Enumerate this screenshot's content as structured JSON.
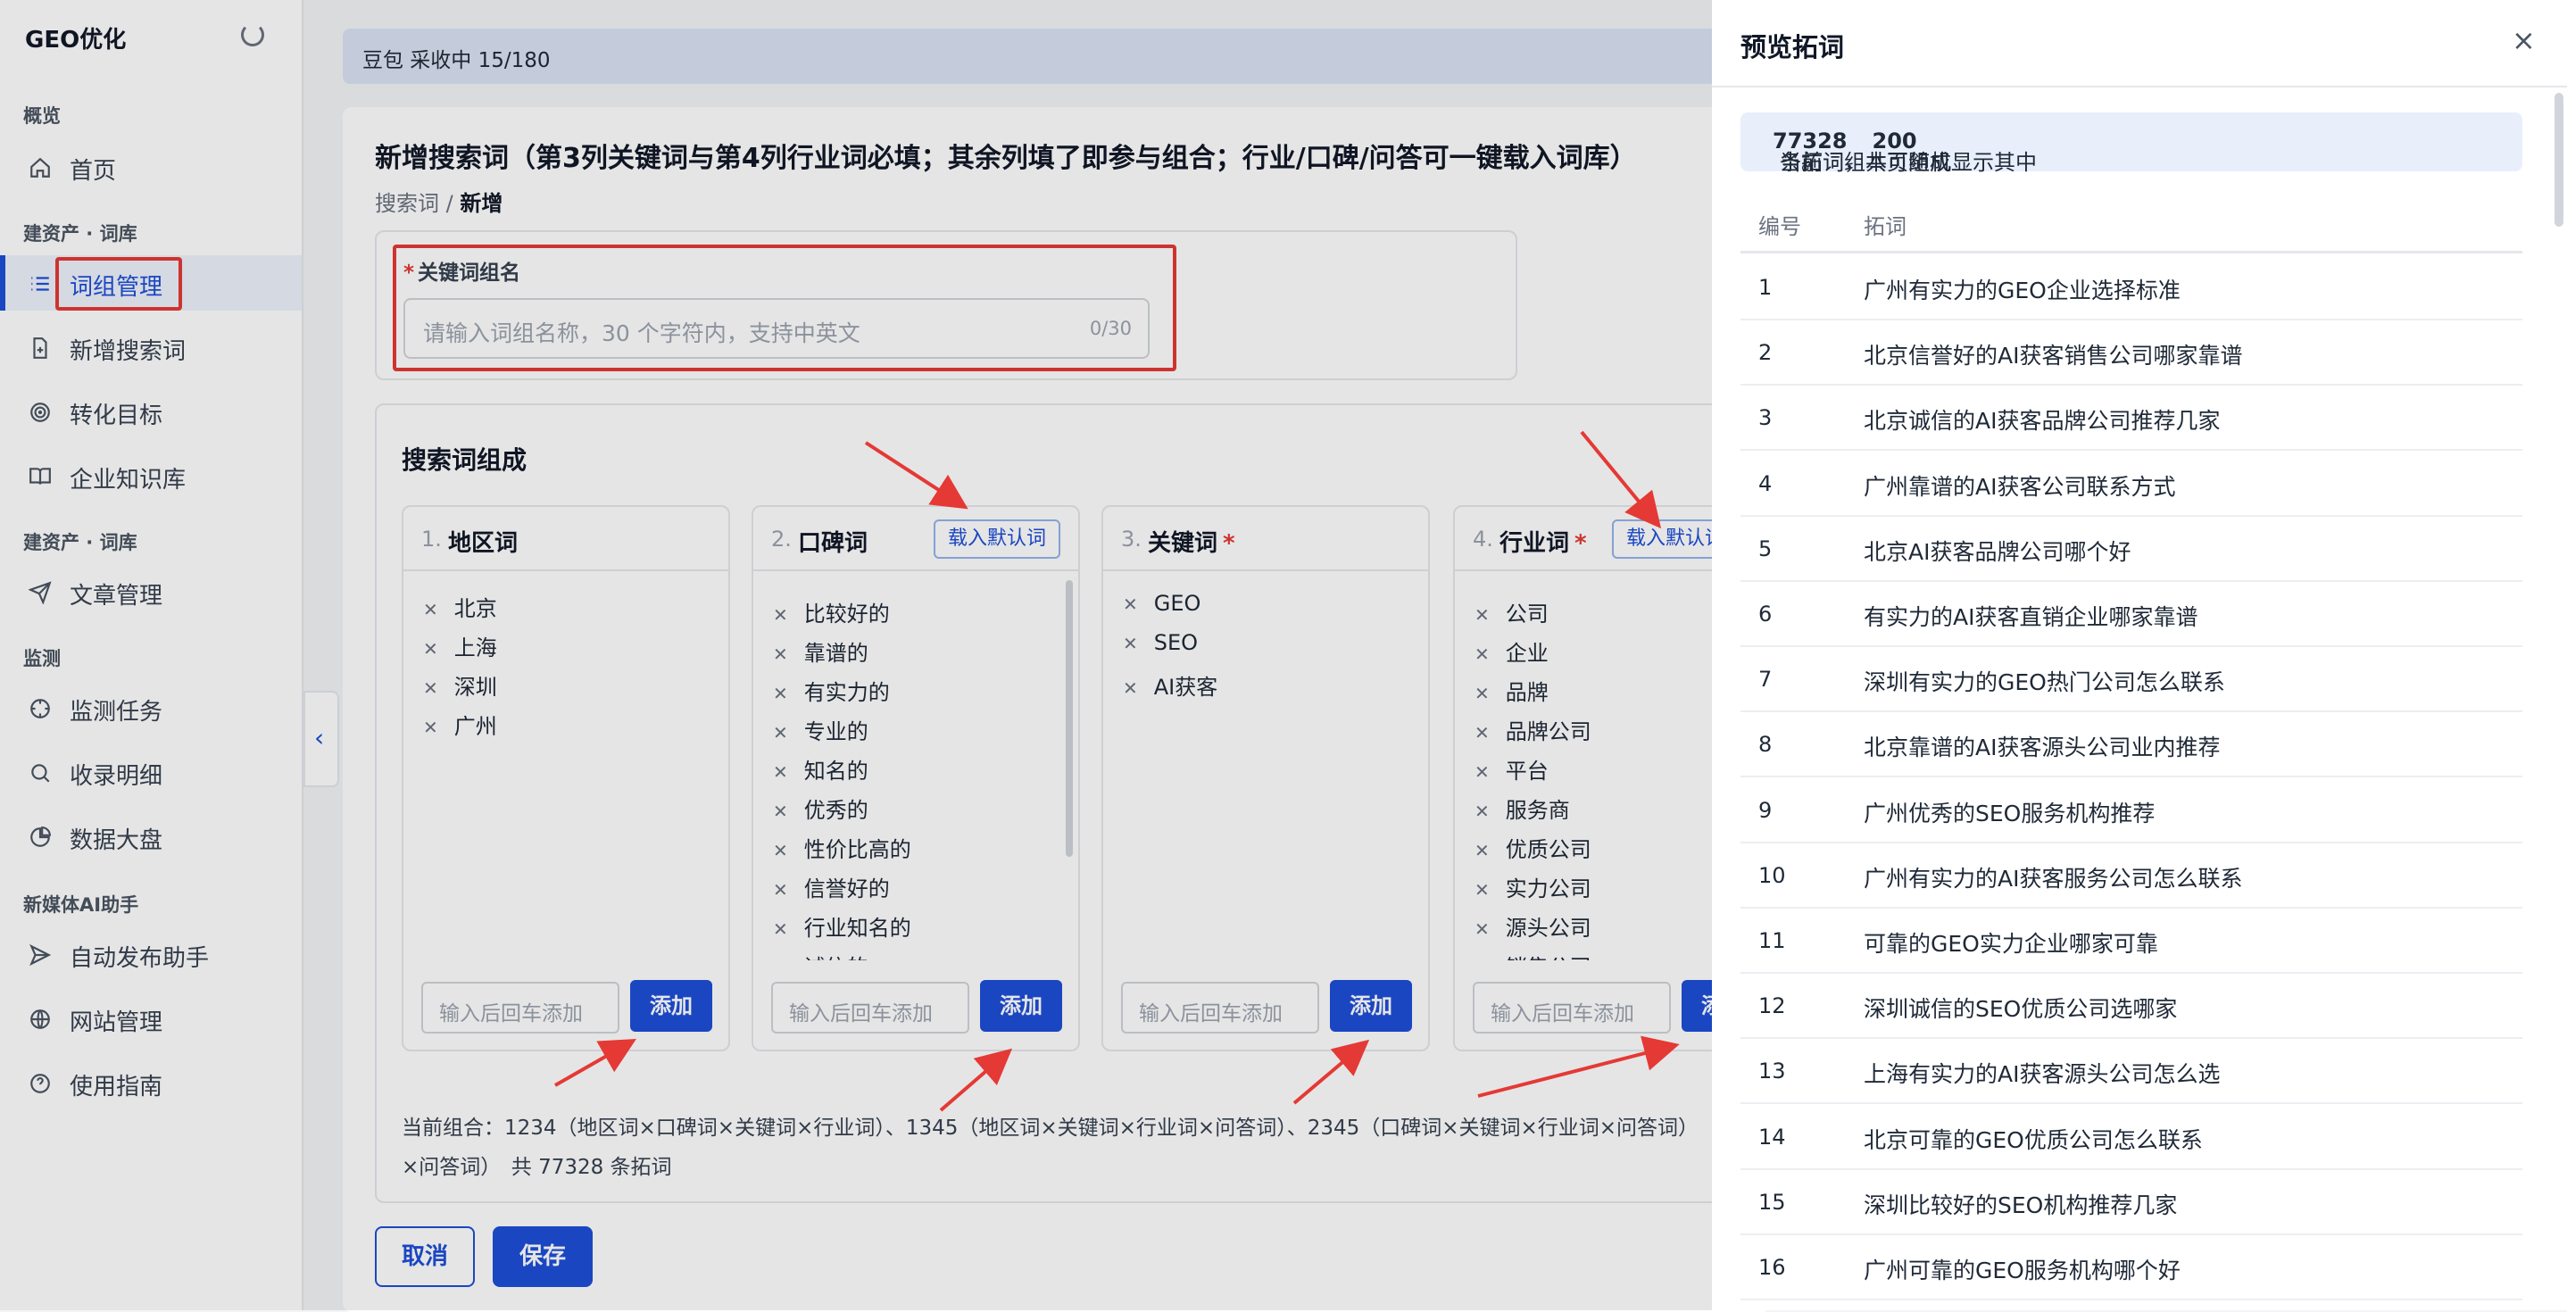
{
  "sidebar": {
    "brand": "GEO优化",
    "sections": {
      "overview": "概览",
      "assets1": "建资产 · 词库",
      "assets2": "建资产 · 词库",
      "monitor": "监测",
      "media": "新媒体AI助手"
    },
    "items": [
      {
        "label": "首页",
        "icon": "home-icon"
      },
      {
        "label": "词组管理",
        "icon": "list-icon"
      },
      {
        "label": "新增搜索词",
        "icon": "file-plus-icon"
      },
      {
        "label": "转化目标",
        "icon": "target-icon"
      },
      {
        "label": "企业知识库",
        "icon": "book-icon"
      },
      {
        "label": "文章管理",
        "icon": "send-icon"
      },
      {
        "label": "监测任务",
        "icon": "crosshair-icon"
      },
      {
        "label": "收录明细",
        "icon": "search-icon"
      },
      {
        "label": "数据大盘",
        "icon": "pie-chart-icon"
      },
      {
        "label": "自动发布助手",
        "icon": "send-icon"
      },
      {
        "label": "网站管理",
        "icon": "globe-icon"
      },
      {
        "label": "使用指南",
        "icon": "help-icon"
      }
    ]
  },
  "topbar": {
    "status": "豆包 采收中 15/180"
  },
  "page": {
    "title": "新增搜索词（第3列关键词与第4列行业词必填；其余列填了即参与组合；行业/口碑/问答可一键载入词库）",
    "breadcrumb_root": "搜索词 /",
    "breadcrumb_current": "新增"
  },
  "group_name": {
    "label": "关键词组名",
    "required_mark": "*",
    "placeholder": "请输入词组名称，30 个字符内，支持中英文",
    "counter": "0/30"
  },
  "composition": {
    "title": "搜索词组成",
    "columns": [
      {
        "num": "1.",
        "title": "地区词",
        "required": "",
        "load_label": "",
        "tags": [
          "北京",
          "上海",
          "深圳",
          "广州"
        ],
        "input_placeholder": "输入后回车添加",
        "add_label": "添加"
      },
      {
        "num": "2.",
        "title": "口碑词",
        "required": "",
        "load_label": "载入默认词",
        "tags": [
          "比较好的",
          "靠谱的",
          "有实力的",
          "专业的",
          "知名的",
          "优秀的",
          "性价比高的",
          "信誉好的",
          "行业知名的",
          "诚信的"
        ],
        "input_placeholder": "输入后回车添加",
        "add_label": "添加"
      },
      {
        "num": "3.",
        "title": "关键词",
        "required": "*",
        "load_label": "",
        "tags": [
          "GEO",
          "SEO",
          "AI获客"
        ],
        "input_placeholder": "输入后回车添加",
        "add_label": "添加"
      },
      {
        "num": "4.",
        "title": "行业词",
        "required": "*",
        "load_label": "载入默认词",
        "tags": [
          "公司",
          "企业",
          "品牌",
          "品牌公司",
          "平台",
          "服务商",
          "优质公司",
          "实力公司",
          "源头公司",
          "销售公司"
        ],
        "input_placeholder": "输入后回车添加",
        "add_label": "添加"
      }
    ],
    "combo_line1": "当前组合：1234（地区词×口碑词×关键词×行业词）、1345（地区词×关键词×行业词×问答词）、2345（口碑词×关键词×行业词×问答词）",
    "combo_line2": "×问答词）　共 77328 条拓词"
  },
  "actions": {
    "cancel": "取消",
    "save": "保存"
  },
  "drawer": {
    "title": "预览拓词",
    "close": "×",
    "notice_pre": "当前词组共可组成",
    "notice_total": "77328",
    "notice_mid": "条拓词，本页随机显示其中",
    "notice_shown": "200",
    "notice_post": "条。",
    "col_num": "编号",
    "col_word": "拓词",
    "rows": [
      {
        "n": "1",
        "w": "广州有实力的GEO企业选择标准"
      },
      {
        "n": "2",
        "w": "北京信誉好的AI获客销售公司哪家靠谱"
      },
      {
        "n": "3",
        "w": "北京诚信的AI获客品牌公司推荐几家"
      },
      {
        "n": "4",
        "w": "广州靠谱的AI获客公司联系方式"
      },
      {
        "n": "5",
        "w": "北京AI获客品牌公司哪个好"
      },
      {
        "n": "6",
        "w": "有实力的AI获客直销企业哪家靠谱"
      },
      {
        "n": "7",
        "w": "深圳有实力的GEO热门公司怎么联系"
      },
      {
        "n": "8",
        "w": "北京靠谱的AI获客源头公司业内推荐"
      },
      {
        "n": "9",
        "w": "广州优秀的SEO服务机构推荐"
      },
      {
        "n": "10",
        "w": "广州有实力的AI获客服务公司怎么联系"
      },
      {
        "n": "11",
        "w": "可靠的GEO实力企业哪家可靠"
      },
      {
        "n": "12",
        "w": "深圳诚信的SEO优质公司选哪家"
      },
      {
        "n": "13",
        "w": "上海有实力的AI获客源头公司怎么选"
      },
      {
        "n": "14",
        "w": "北京可靠的GEO优质公司怎么联系"
      },
      {
        "n": "15",
        "w": "深圳比较好的SEO机构推荐几家"
      },
      {
        "n": "16",
        "w": "广州可靠的GEO服务机构哪个好"
      }
    ]
  },
  "colors": {
    "primary": "#1d4ed8",
    "highlight": "#e53935"
  }
}
